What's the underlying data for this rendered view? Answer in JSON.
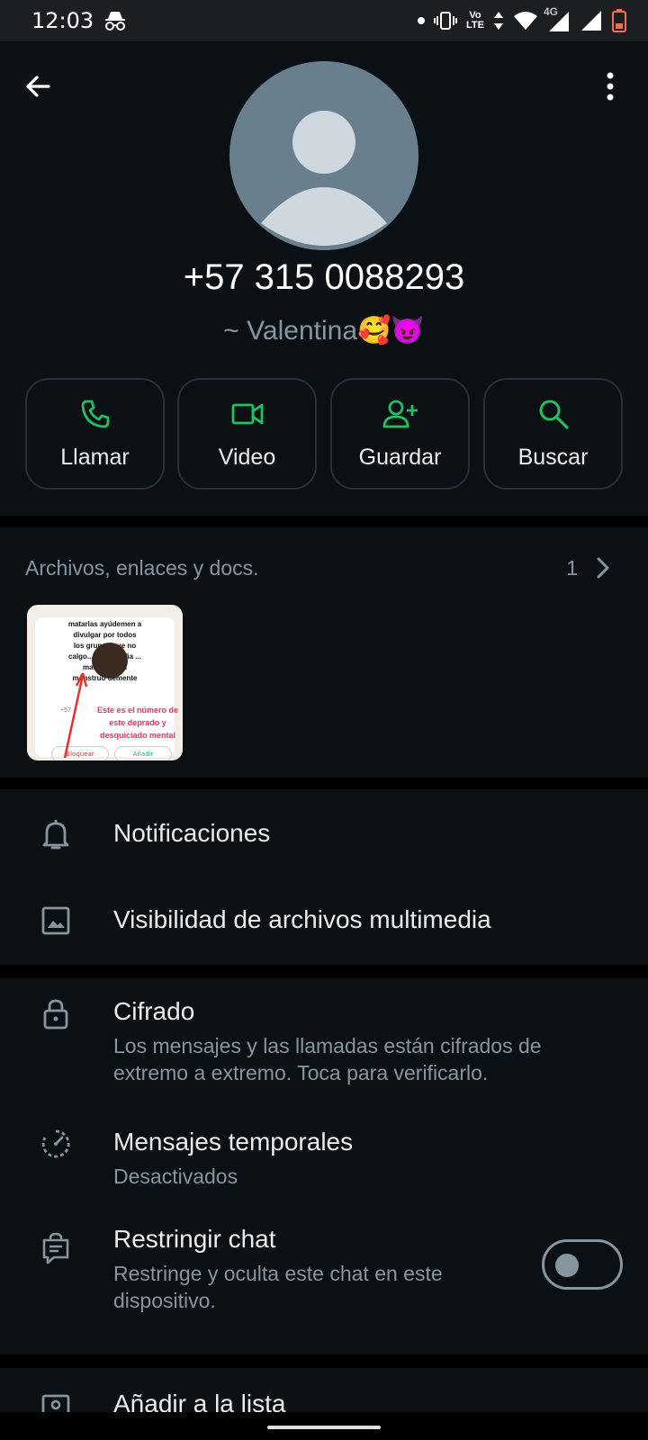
{
  "status_bar": {
    "time": "12:03",
    "network_top": "Vo",
    "network_bottom": "LTE",
    "mobile_data": "4G"
  },
  "contact": {
    "phone": "+57 315 0088293",
    "alias": "~ Valentina🥰😈"
  },
  "actions": [
    {
      "label": "Llamar",
      "icon": "phone-icon"
    },
    {
      "label": "Video",
      "icon": "video-icon"
    },
    {
      "label": "Guardar",
      "icon": "add-person-icon"
    },
    {
      "label": "Buscar",
      "icon": "search-icon"
    }
  ],
  "media": {
    "title": "Archivos, enlaces y docs.",
    "count": "1",
    "thumbnail": {
      "text_top": "matarlas ayúdemen a divulgar por todos los grupos que no calgo... ni una niña ... manos es un monstruo demente",
      "text_mid": "Este es el número de este deprado y desquiciado mental",
      "text_small": "+57",
      "button_left": "Bloquear",
      "button_right": "Añadir"
    }
  },
  "settings": {
    "notifications": "Notificaciones",
    "media_visibility": "Visibilidad de archivos multimedia",
    "encryption_title": "Cifrado",
    "encryption_sub": "Los mensajes y las llamadas están cifrados de extremo a extremo. Toca para verificarlo.",
    "disappearing_title": "Mensajes temporales",
    "disappearing_sub": "Desactivados",
    "lock_title": "Restringir chat",
    "lock_sub": "Restringe y oculta este chat en este dispositivo.",
    "lock_enabled": false,
    "add_to_list": "Añadir a la lista"
  },
  "colors": {
    "accent": "#21c063",
    "background": "#0b1014",
    "divider": "#000000",
    "secondary_text": "#8696a0"
  }
}
